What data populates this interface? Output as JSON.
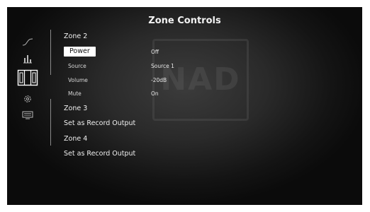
{
  "header": {
    "title": "Zone Controls"
  },
  "background": {
    "logo_text": "NAD"
  },
  "sidebar": {
    "icons": [
      {
        "name": "eq-wave-icon"
      },
      {
        "name": "sliders-icon"
      },
      {
        "name": "zone-window-icon"
      },
      {
        "name": "gear-icon"
      },
      {
        "name": "display-icon"
      }
    ]
  },
  "menu": {
    "zone2": {
      "label": "Zone 2",
      "settings": [
        {
          "label": "Power",
          "value": "Off"
        },
        {
          "label": "Source",
          "value": "Source 1"
        },
        {
          "label": "Volume",
          "value": "-20dB"
        },
        {
          "label": "Mute",
          "value": "On"
        }
      ]
    },
    "zone3": {
      "label": "Zone 3",
      "record": "Set as Record Output"
    },
    "zone4": {
      "label": "Zone 4",
      "record": "Set as Record Output"
    }
  },
  "colors": {
    "accent": "#ffffff",
    "background": "#1c1c1c",
    "text": "#f0f0f0"
  }
}
